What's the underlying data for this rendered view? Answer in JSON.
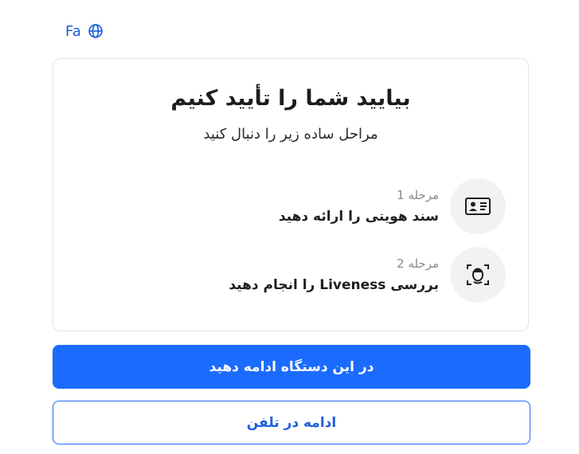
{
  "language": {
    "code": "Fa",
    "icon": "globe-icon"
  },
  "card": {
    "title": "بیایید شما را تأیید کنیم",
    "subtitle": "مراحل ساده زیر را دنبال کنید",
    "steps": [
      {
        "number": "مرحله 1",
        "label": "سند هویتی را ارائه دهید",
        "icon": "id-card-icon"
      },
      {
        "number": "مرحله 2",
        "label": "بررسی Liveness را انجام دهید",
        "icon": "face-scan-icon"
      }
    ]
  },
  "actions": {
    "continue_device": "در این دستگاه ادامه دهید",
    "continue_phone": "ادامه در تلفن"
  },
  "colors": {
    "primary": "#1c6bff",
    "link": "#1a5fe0",
    "icon_bg": "#f2f2f2"
  }
}
